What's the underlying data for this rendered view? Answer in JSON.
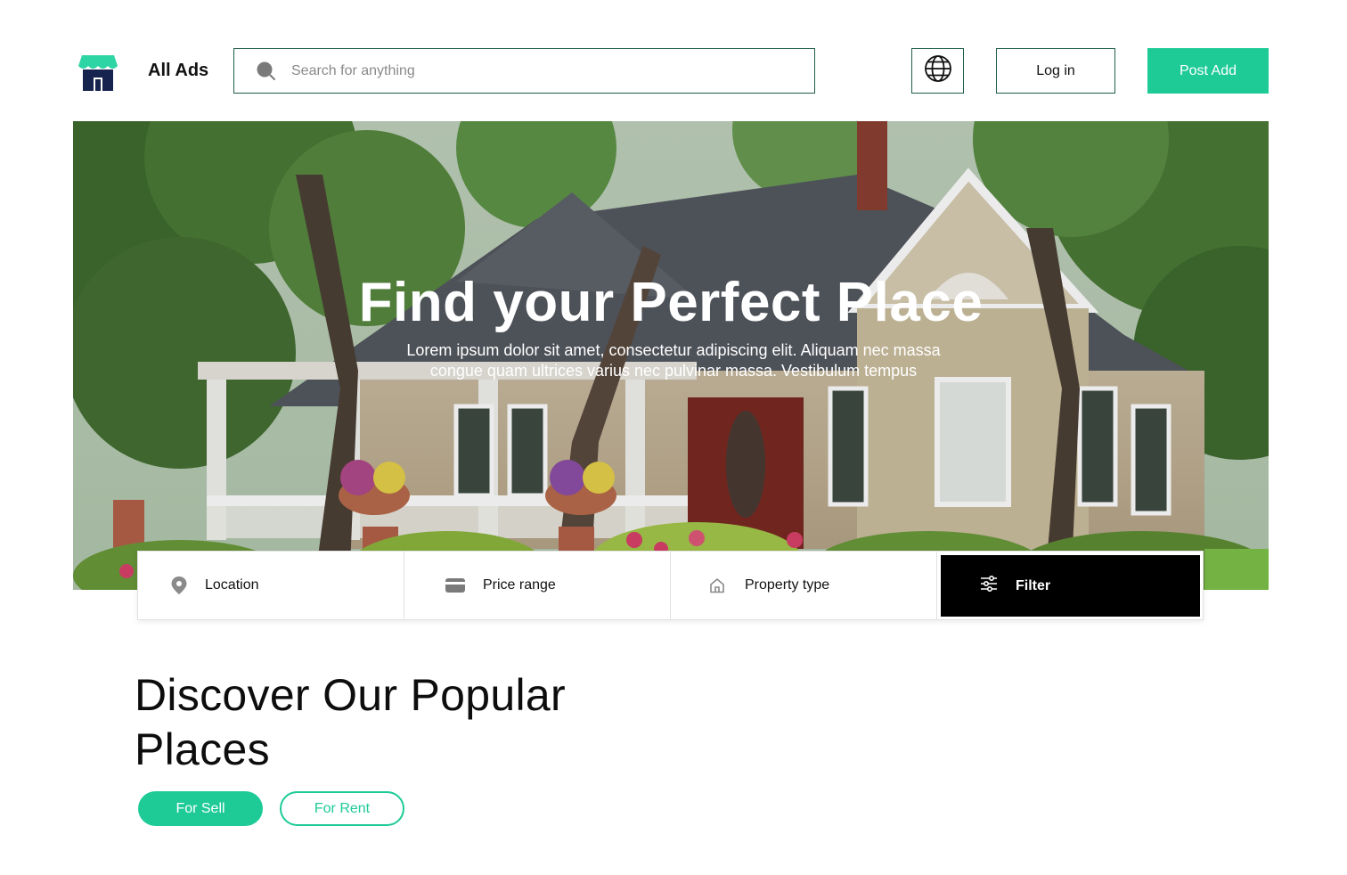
{
  "header": {
    "brand": "All Ads",
    "search_placeholder": "Search for anything",
    "login_label": "Log in",
    "post_label": "Post Add"
  },
  "hero": {
    "title": "Find your Perfect Place",
    "subtitle": "Lorem ipsum dolor sit amet, consectetur adipiscing elit. Aliquam nec massa congue quam ultrices varius nec pulvinar massa. Vestibulum tempus"
  },
  "filters": {
    "location": "Location",
    "price_range": "Price range",
    "property_type": "Property type",
    "filter": "Filter"
  },
  "section": {
    "title": "Discover Our Popular Places",
    "tabs": [
      "For Sell",
      "For Rent"
    ],
    "active_tab": "For Sell"
  },
  "colors": {
    "accent": "#1ecb97",
    "border": "#1f5c4a",
    "logo_roof": "#2dd4a4",
    "logo_body": "#16234f"
  },
  "icons": {
    "logo": "storefront-icon",
    "search": "search-icon",
    "language": "globe-icon",
    "location": "map-pin-icon",
    "price": "credit-card-icon",
    "property": "home-icon",
    "filter": "sliders-icon"
  }
}
